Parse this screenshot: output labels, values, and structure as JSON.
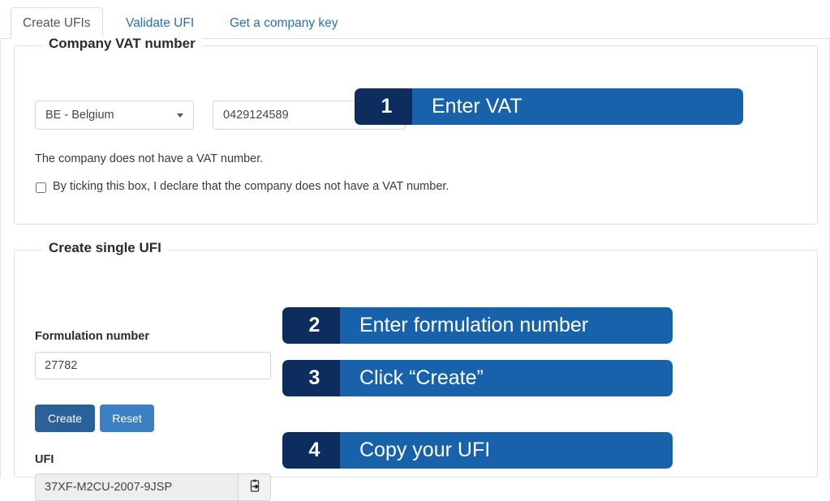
{
  "tabs": [
    {
      "label": "Create UFIs",
      "active": true
    },
    {
      "label": "Validate UFI",
      "active": false
    },
    {
      "label": "Get a company key",
      "active": false
    }
  ],
  "vat_section": {
    "legend": "Company VAT number",
    "country_select": {
      "value": "BE - Belgium",
      "icon": "chevron-down-icon"
    },
    "vat_input": {
      "value": "0429124589",
      "placeholder": ""
    },
    "no_vat_text": "The company does not have a VAT number.",
    "declaration_label": "By ticking this box, I declare that the company does not have a VAT number.",
    "declaration_checked": false
  },
  "single_ufi_section": {
    "legend": "Create single UFI",
    "formulation_label": "Formulation number",
    "formulation_input": {
      "value": "27782",
      "placeholder": ""
    },
    "create_button": "Create",
    "reset_button": "Reset",
    "ufi_label": "UFI",
    "ufi_input": {
      "value": "37XF-M2CU-2007-9JSP",
      "placeholder": ""
    },
    "copy_icon": "clipboard-copy-icon"
  },
  "callouts": [
    {
      "number": "1",
      "text": "Enter VAT"
    },
    {
      "number": "2",
      "text": "Enter formulation number"
    },
    {
      "number": "3",
      "text": "Click “Create”"
    },
    {
      "number": "4",
      "text": "Copy your UFI"
    }
  ],
  "colors": {
    "callout_number_bg": "#0c2d5e",
    "callout_body_bg": "#1862ab",
    "create_button_bg": "#2b6199",
    "reset_button_bg": "#3b80c4",
    "tab_link": "#2a6eb5"
  }
}
